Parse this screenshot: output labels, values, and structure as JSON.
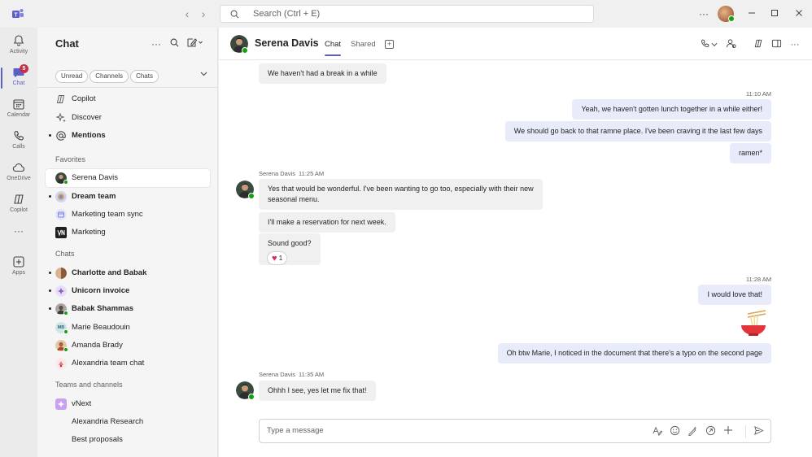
{
  "titlebar": {
    "search_placeholder": "Search (Ctrl + E)",
    "more_label": "···"
  },
  "rail": {
    "items": [
      {
        "label": "Activity",
        "icon": "bell-icon"
      },
      {
        "label": "Chat",
        "icon": "chat-icon",
        "badge": "5",
        "active": true
      },
      {
        "label": "Calendar",
        "icon": "calendar-icon"
      },
      {
        "label": "Calls",
        "icon": "phone-icon"
      },
      {
        "label": "OneDrive",
        "icon": "cloud-icon"
      },
      {
        "label": "Copilot",
        "icon": "copilot-icon"
      },
      {
        "label": "Apps",
        "icon": "apps-icon"
      }
    ],
    "more": "···"
  },
  "sidebar": {
    "title": "Chat",
    "filters": [
      "Unread",
      "Channels",
      "Chats"
    ],
    "top_items": [
      {
        "label": "Copilot",
        "icon": "copilot-icon"
      },
      {
        "label": "Discover",
        "icon": "sparkle-icon"
      },
      {
        "label": "Mentions",
        "icon": "at-icon",
        "bold": true
      }
    ],
    "favorites_label": "Favorites",
    "favorites": [
      {
        "label": "Serena Davis",
        "selected": true
      },
      {
        "label": "Dream team",
        "bold": true
      },
      {
        "label": "Marketing team sync"
      },
      {
        "label": "Marketing"
      }
    ],
    "chats_label": "Chats",
    "chats": [
      {
        "label": "Charlotte and Babak",
        "bold": true
      },
      {
        "label": "Unicorn invoice",
        "bold": true
      },
      {
        "label": "Babak Shammas",
        "bold": true
      },
      {
        "label": "Marie Beaudouin",
        "initials": "MB"
      },
      {
        "label": "Amanda Brady"
      },
      {
        "label": "Alexandria team chat"
      }
    ],
    "teams_label": "Teams and channels",
    "teams": [
      {
        "label": "vNext"
      },
      {
        "label": "Alexandria Research"
      },
      {
        "label": "Best proposals"
      }
    ]
  },
  "header": {
    "name": "Serena Davis",
    "tabs": [
      "Chat",
      "Shared"
    ]
  },
  "messages": {
    "m0": "We haven't had a break in a while",
    "t1": "11:10 AM",
    "m1": "Yeah, we haven't gotten lunch together in a while either!",
    "m2": "We should go back to that ramne place. I've been craving it the last few days",
    "m3": "ramen*",
    "s1_name": "Serena Davis",
    "s1_time": "11:25 AM",
    "m4a": "Yes that would be wonderful. I've been wanting to go too, especially with their new",
    "m4b": "seasonal menu.",
    "m5": "I'll make a reservation for next week.",
    "m6": "Sound good?",
    "reaction_count": "1",
    "t2": "11:28 AM",
    "m7": "I would love that!",
    "m8": "Oh btw Marie, I noticed in the document that there's a typo on the second page",
    "s2_name": "Serena Davis",
    "s2_time": "11:35 AM",
    "m9": "Ohhh I see, yes let me fix that!"
  },
  "composer": {
    "placeholder": "Type a message"
  },
  "colors": {
    "accent": "#5b5fc7",
    "presence": "#13a10e",
    "badge": "#c4314b",
    "outgoing_bubble": "#e8ebfa"
  }
}
